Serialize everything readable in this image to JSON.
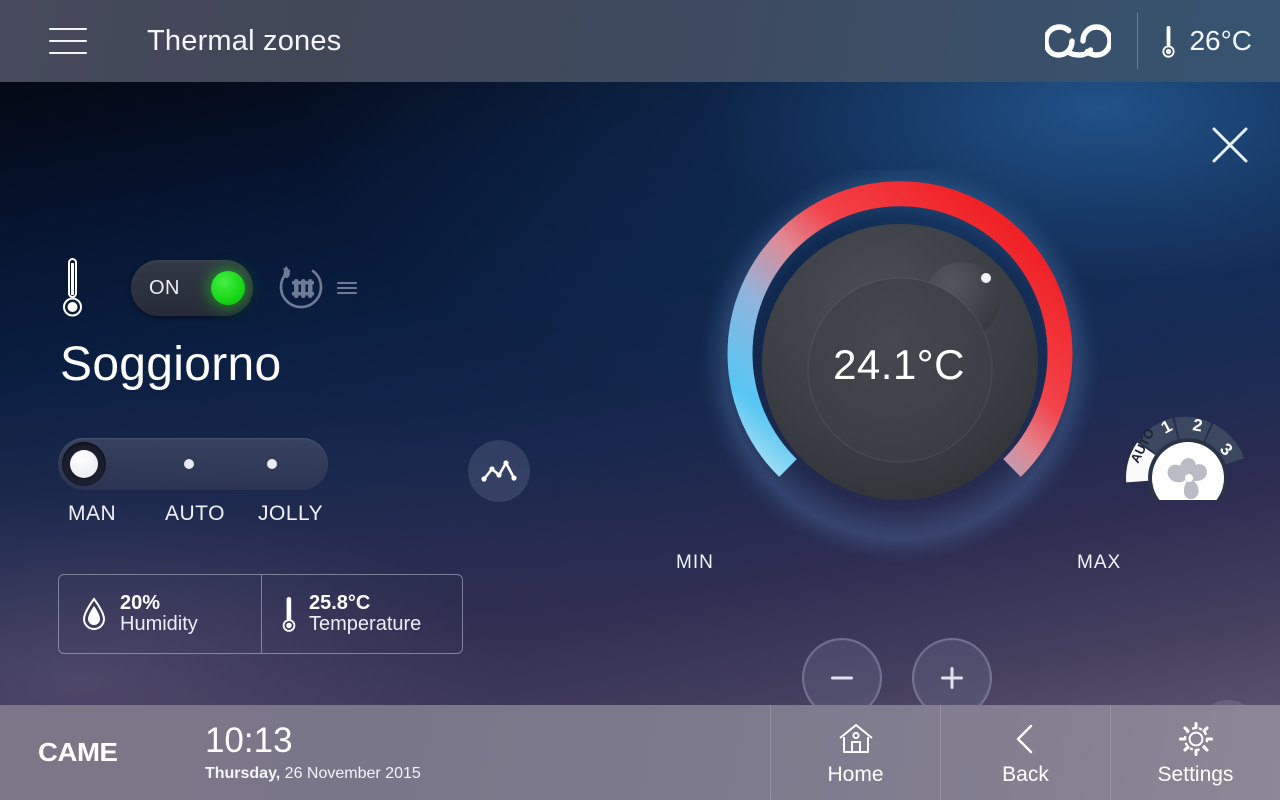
{
  "header": {
    "menu_icon": "hamburger-icon",
    "title": "Thermal zones",
    "brand_icon": "came-cloud-logo",
    "outdoor_icon": "thermometer-icon",
    "outdoor_temp": "26°C"
  },
  "zone": {
    "thermometer_icon": "thermometer-icon",
    "power_label": "ON",
    "power_state": "on",
    "heating_icon": "radiator-flame-icon",
    "waves_icon": "heat-waves-icon",
    "name": "Soggiorno",
    "close_icon": "close-icon"
  },
  "modes": {
    "selected": "MAN",
    "items": [
      {
        "label": "MAN"
      },
      {
        "label": "AUTO"
      },
      {
        "label": "JOLLY"
      }
    ],
    "chart_icon": "line-chart-icon"
  },
  "sensors": [
    {
      "icon": "humidity-drop-icon",
      "value": "20%",
      "label": "Humidity"
    },
    {
      "icon": "thermometer-icon",
      "value": "25.8°C",
      "label": "Temperature"
    }
  ],
  "dial": {
    "setpoint": "24.1°C",
    "min_label": "MIN",
    "max_label": "MAX",
    "min_value": 0,
    "max_value": 100,
    "current_percent": 62,
    "cold_color": "#4fc3f7",
    "hot_color": "#f01c1c",
    "knob_color": "#3b3d44"
  },
  "stepper": {
    "decrease_icon": "minus-icon",
    "decrease_label": "-",
    "increase_icon": "plus-icon",
    "increase_label": "+"
  },
  "fan": {
    "selected": "AUTO",
    "icon": "fan-icon",
    "steps": [
      {
        "label": "AUTO"
      },
      {
        "label": "1"
      },
      {
        "label": "2"
      },
      {
        "label": "3"
      }
    ]
  },
  "tools": {
    "wrench_icon": "wrench-icon"
  },
  "footer": {
    "brand": "CAME",
    "time": "10:13",
    "weekday": "Thursday,",
    "date": " 26 November 2015",
    "nav": [
      {
        "icon": "home-icon",
        "label": "Home"
      },
      {
        "icon": "chevron-left-icon",
        "label": "Back"
      },
      {
        "icon": "gear-icon",
        "label": "Settings"
      }
    ]
  }
}
